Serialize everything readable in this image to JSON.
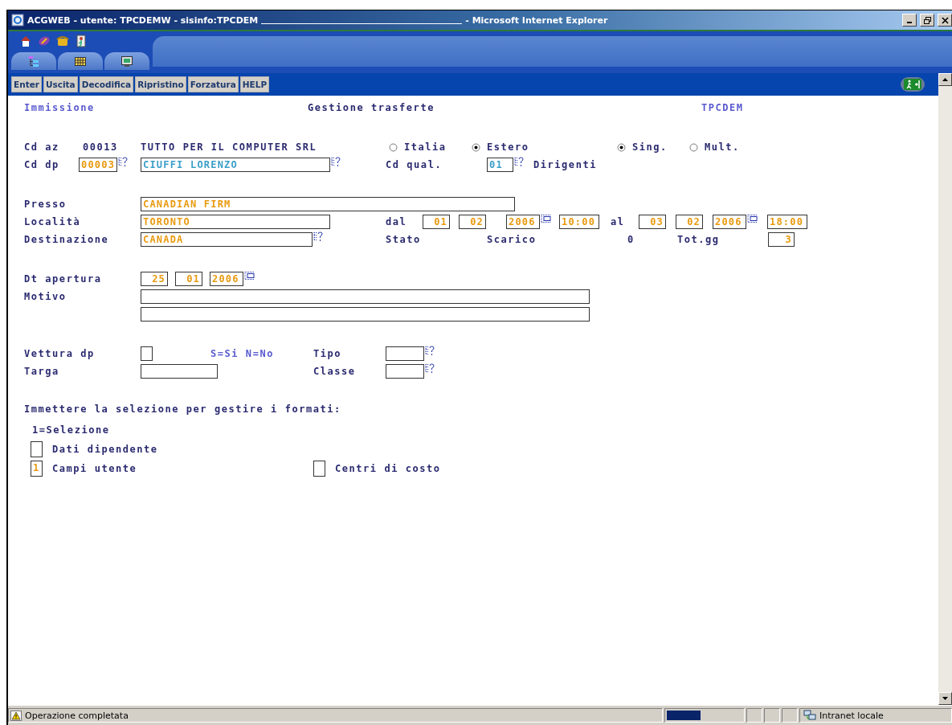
{
  "window": {
    "title": "ACGWEB - utente: TPCDEMW - sisinfo:TPCDEM",
    "app": "- Microsoft Internet Explorer"
  },
  "toolbar_tabs": [
    {
      "selected": false
    },
    {
      "selected": false
    },
    {
      "selected": false
    }
  ],
  "buttons": [
    "Enter",
    "Uscita",
    "Decodifica",
    "Ripristino",
    "Forzatura",
    "HELP"
  ],
  "header": {
    "mode": "Immissione",
    "title": "Gestione trasferte",
    "program": "TPCDEM"
  },
  "company": {
    "label": "Cd az",
    "code": "00013",
    "name": "TUTTO PER IL COMPUTER SRL"
  },
  "area_options": [
    {
      "label": "Italia",
      "selected": false
    },
    {
      "label": "Estero",
      "selected": true
    }
  ],
  "trip_options": [
    {
      "label": "Sing.",
      "selected": true
    },
    {
      "label": "Mult.",
      "selected": false
    }
  ],
  "employee": {
    "label": "Cd dp",
    "code": "00003",
    "name": "CIUFFI LORENZO"
  },
  "qualification": {
    "label": "Cd qual.",
    "code": "01",
    "description": "Dirigenti"
  },
  "presso": {
    "label": "Presso",
    "value": "CANADIAN FIRM"
  },
  "localita": {
    "label": "Località",
    "value": "TORONTO"
  },
  "period": {
    "from_label": "dal",
    "from_day": "01",
    "from_month": "02",
    "from_year": "2006",
    "from_time": "10:00",
    "to_label": "al",
    "to_day": "03",
    "to_month": "02",
    "to_year": "2006",
    "to_time": "18:00"
  },
  "destinazione": {
    "label": "Destinazione",
    "value": "CANADA"
  },
  "stato": {
    "label": "Stato"
  },
  "scarico": {
    "label": "Scarico",
    "value": "0"
  },
  "tot_gg": {
    "label": "Tot.gg",
    "value": "3"
  },
  "apertura": {
    "label": "Dt apertura",
    "day": "25",
    "month": "01",
    "year": "2006"
  },
  "motivo": {
    "label": "Motivo"
  },
  "vettura": {
    "label": "Vettura dp",
    "hint": "S=Si N=No"
  },
  "tipo": {
    "label": "Tipo"
  },
  "targa": {
    "label": "Targa"
  },
  "classe": {
    "label": "Classe"
  },
  "selection": {
    "prompt": "Immettere la selezione per gestire i formati:",
    "legend": "1=Selezione"
  },
  "formats": [
    {
      "label": "Dati dipendente"
    },
    {
      "label": "Campi utente",
      "value": "1"
    },
    {
      "label": "Centri di costo"
    }
  ],
  "status_bar": {
    "message": "Operazione completata",
    "progress": {
      "level": 0.45
    },
    "zone": "Intranet locale"
  }
}
